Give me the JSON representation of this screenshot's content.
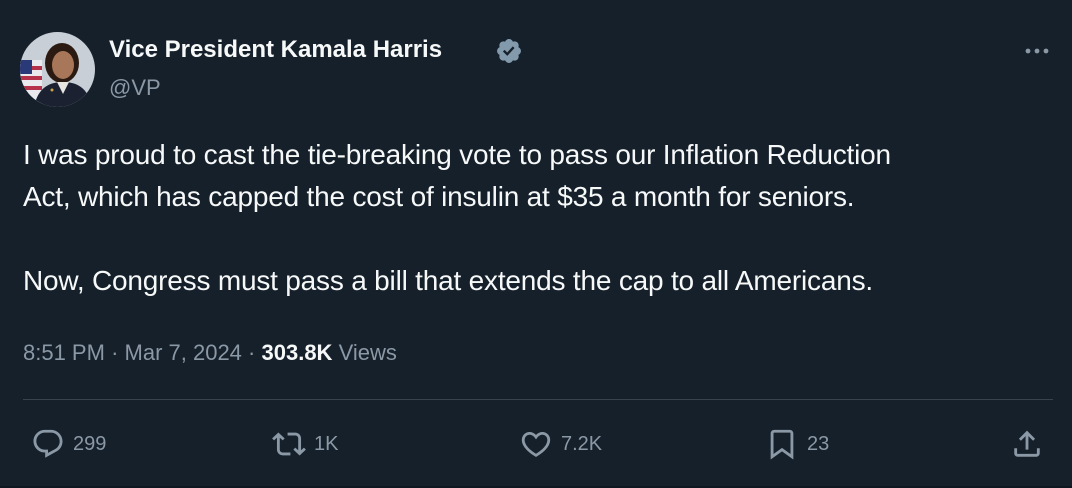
{
  "colors": {
    "background": "#15202b",
    "primary_text": "#f7f9f9",
    "secondary_text": "#8b98a5",
    "divider": "#38444d",
    "verified_badge": "#829aab"
  },
  "author": {
    "display_name": "Vice President Kamala Harris",
    "handle": "@VP",
    "verified_icon": "verified-badge-icon",
    "avatar": "profile-photo"
  },
  "tweet": {
    "paragraphs": [
      "I was proud to cast the tie-breaking vote to pass our Inflation Reduction",
      "Act, which has capped the cost of insulin at $35 a month for seniors.",
      "Now, Congress must pass a bill that extends the cap to all Americans."
    ],
    "time": "8:51 PM",
    "separator": "·",
    "date": "Mar 7, 2024",
    "views_count": "303.8K",
    "views_label": "Views"
  },
  "actions": {
    "replies": {
      "icon": "reply-icon",
      "count": "299"
    },
    "reposts": {
      "icon": "repost-icon",
      "count": "1K"
    },
    "likes": {
      "icon": "heart-icon",
      "count": "7.2K"
    },
    "bookmarks": {
      "icon": "bookmark-icon",
      "count": "23"
    },
    "share": {
      "icon": "share-icon"
    }
  },
  "menu": {
    "icon": "more-options-icon"
  }
}
